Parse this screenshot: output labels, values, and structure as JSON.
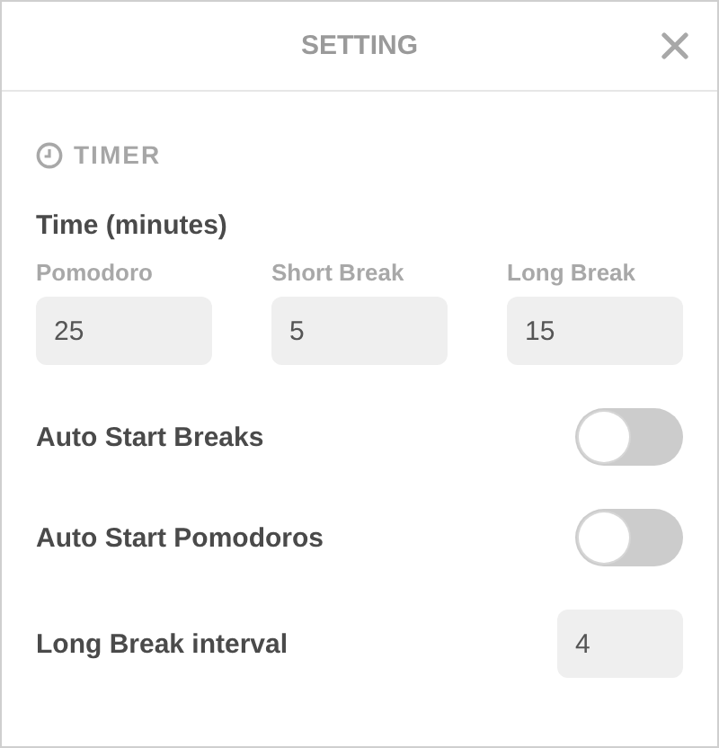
{
  "dialog": {
    "title": "SETTING"
  },
  "section": {
    "title": "TIMER"
  },
  "time": {
    "heading": "Time (minutes)",
    "fields": [
      {
        "label": "Pomodoro",
        "value": "25"
      },
      {
        "label": "Short Break",
        "value": "5"
      },
      {
        "label": "Long Break",
        "value": "15"
      }
    ]
  },
  "settings": [
    {
      "kind": "toggle",
      "label": "Auto Start Breaks",
      "on": false
    },
    {
      "kind": "toggle",
      "label": "Auto Start Pomodoros",
      "on": false
    },
    {
      "kind": "number",
      "label": "Long Break interval",
      "value": "4"
    }
  ]
}
